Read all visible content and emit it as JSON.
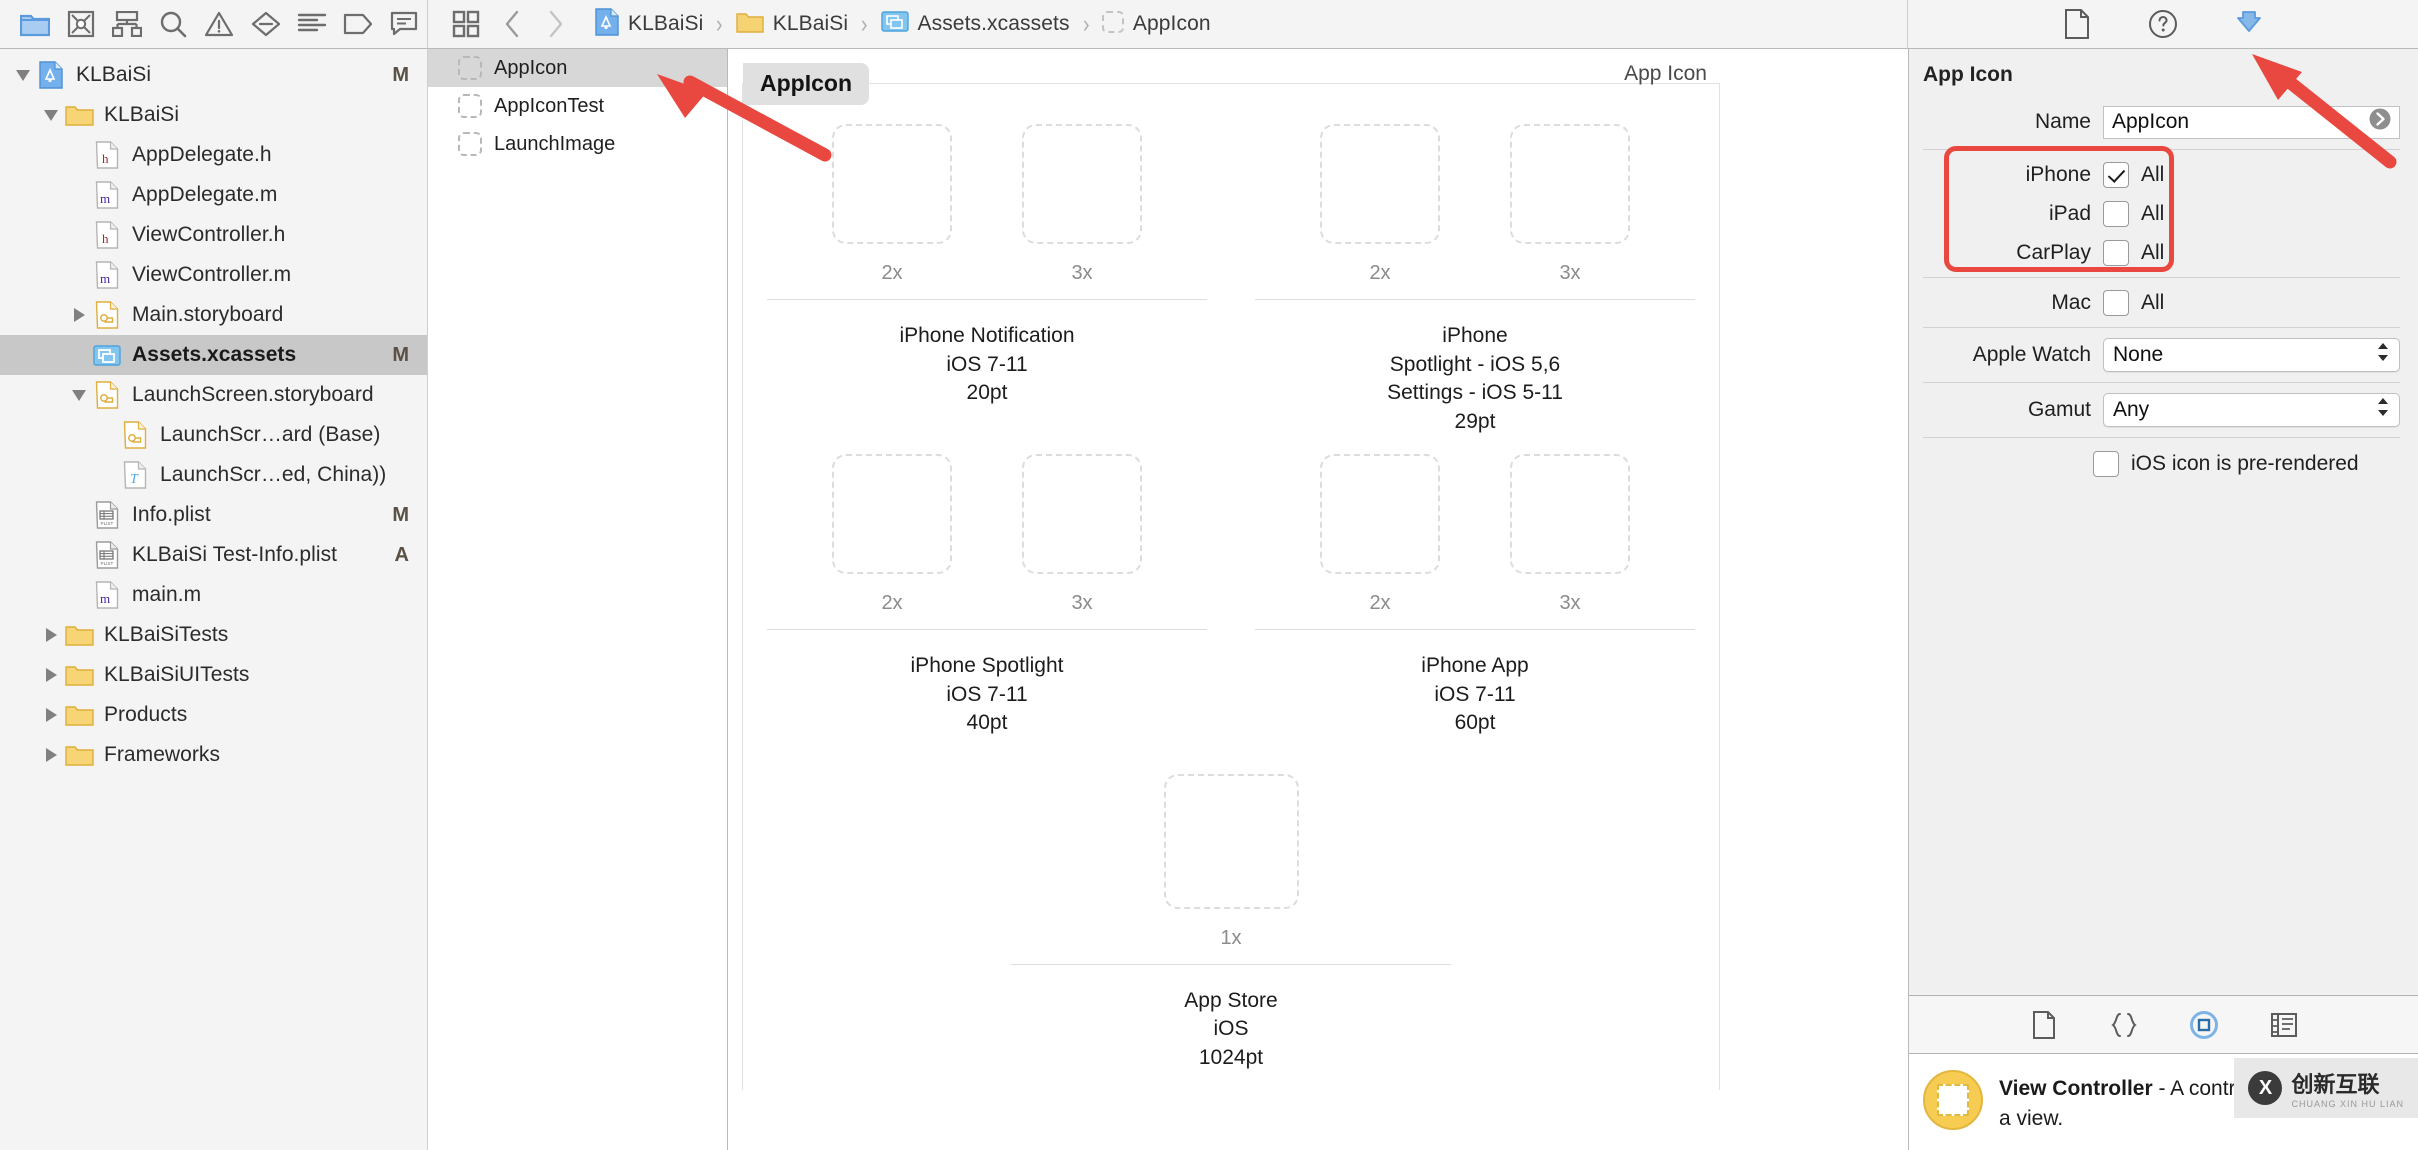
{
  "toolbar": {
    "left_icons": [
      {
        "name": "folder-icon",
        "label": "Show the Project navigator",
        "active": true
      },
      {
        "name": "source-control-icon",
        "label": "Show the Source Control navigator",
        "active": false
      },
      {
        "name": "hierarchy-icon",
        "label": "Show the Symbol navigator",
        "active": false
      },
      {
        "name": "search-icon",
        "label": "Show the Find navigator",
        "active": false
      },
      {
        "name": "warning-icon",
        "label": "Show the Issue navigator",
        "active": false
      },
      {
        "name": "test-icon",
        "label": "Show the Test navigator",
        "active": false
      },
      {
        "name": "debug-icon",
        "label": "Show the Debug navigator",
        "active": false
      },
      {
        "name": "breakpoint-icon",
        "label": "Show the Breakpoint navigator",
        "active": false
      },
      {
        "name": "report-icon",
        "label": "Show the Report navigator",
        "active": false
      }
    ],
    "grid_button": "editor-layout-icon",
    "back_button": "chevron-left-icon",
    "forward_button": "chevron-right-icon",
    "right_icons": [
      {
        "name": "file-inspector-icon",
        "label": "File inspector",
        "active": false
      },
      {
        "name": "quick-help-icon",
        "label": "Quick Help inspector",
        "active": false
      },
      {
        "name": "attributes-inspector-icon",
        "label": "Attributes inspector",
        "active": true
      }
    ]
  },
  "breadcrumb": [
    {
      "label": "KLBaiSi",
      "icon": "xcode-project-icon"
    },
    {
      "label": "KLBaiSi",
      "icon": "folder-icon"
    },
    {
      "label": "Assets.xcassets",
      "icon": "assets-catalog-icon"
    },
    {
      "label": "AppIcon",
      "icon": "appicon-placeholder-icon"
    }
  ],
  "breadcrumb_separator": "›",
  "navigator": {
    "items": [
      {
        "label": "KLBaiSi",
        "icon": "xcode-project-icon",
        "indent": 0,
        "disclosure": "open",
        "status": "M",
        "selected": false
      },
      {
        "label": "KLBaiSi",
        "icon": "folder-icon",
        "indent": 1,
        "disclosure": "open",
        "status": "",
        "selected": false
      },
      {
        "label": "AppDelegate.h",
        "icon": "header-file-icon",
        "indent": 2,
        "disclosure": "none",
        "status": "",
        "selected": false
      },
      {
        "label": "AppDelegate.m",
        "icon": "objc-file-icon",
        "indent": 2,
        "disclosure": "none",
        "status": "",
        "selected": false
      },
      {
        "label": "ViewController.h",
        "icon": "header-file-icon",
        "indent": 2,
        "disclosure": "none",
        "status": "",
        "selected": false
      },
      {
        "label": "ViewController.m",
        "icon": "objc-file-icon",
        "indent": 2,
        "disclosure": "none",
        "status": "",
        "selected": false
      },
      {
        "label": "Main.storyboard",
        "icon": "storyboard-file-icon",
        "indent": 2,
        "disclosure": "closed",
        "status": "",
        "selected": false
      },
      {
        "label": "Assets.xcassets",
        "icon": "assets-catalog-icon",
        "indent": 2,
        "disclosure": "none",
        "status": "M",
        "selected": true
      },
      {
        "label": "LaunchScreen.storyboard",
        "icon": "storyboard-file-icon",
        "indent": 2,
        "disclosure": "open",
        "status": "",
        "selected": false
      },
      {
        "label": "LaunchScr…ard (Base)",
        "icon": "storyboard-file-icon",
        "indent": 3,
        "disclosure": "none",
        "status": "",
        "selected": false
      },
      {
        "label": "LaunchScr…ed, China))",
        "icon": "strings-file-icon",
        "indent": 3,
        "disclosure": "none",
        "status": "",
        "selected": false
      },
      {
        "label": "Info.plist",
        "icon": "plist-file-icon",
        "indent": 2,
        "disclosure": "none",
        "status": "M",
        "selected": false
      },
      {
        "label": "KLBaiSi Test-Info.plist",
        "icon": "plist-file-icon",
        "indent": 2,
        "disclosure": "none",
        "status": "A",
        "selected": false
      },
      {
        "label": "main.m",
        "icon": "objc-file-icon",
        "indent": 2,
        "disclosure": "none",
        "status": "",
        "selected": false
      },
      {
        "label": "KLBaiSiTests",
        "icon": "folder-icon",
        "indent": 1,
        "disclosure": "closed",
        "status": "",
        "selected": false
      },
      {
        "label": "KLBaiSiUITests",
        "icon": "folder-icon",
        "indent": 1,
        "disclosure": "closed",
        "status": "",
        "selected": false
      },
      {
        "label": "Products",
        "icon": "folder-icon",
        "indent": 1,
        "disclosure": "closed",
        "status": "",
        "selected": false
      },
      {
        "label": "Frameworks",
        "icon": "folder-icon",
        "indent": 1,
        "disclosure": "closed",
        "status": "",
        "selected": false
      }
    ]
  },
  "asset_list": {
    "items": [
      {
        "label": "AppIcon",
        "selected": true
      },
      {
        "label": "AppIconTest",
        "selected": false
      },
      {
        "label": "LaunchImage",
        "selected": false
      }
    ]
  },
  "canvas": {
    "title": "AppIcon",
    "corner_label": "App Icon",
    "groups": [
      {
        "caption_line1": "iPhone Notification",
        "caption_line2": "iOS 7-11",
        "caption_line3": "20pt",
        "slots": [
          {
            "scale": "2x"
          },
          {
            "scale": "3x"
          }
        ]
      },
      {
        "caption_line1": "iPhone",
        "caption_line2": "Spotlight - iOS 5,6",
        "caption_line3": "Settings - iOS 5-11",
        "caption_line4": "29pt",
        "slots": [
          {
            "scale": "2x"
          },
          {
            "scale": "3x"
          }
        ]
      },
      {
        "caption_line1": "iPhone Spotlight",
        "caption_line2": "iOS 7-11",
        "caption_line3": "40pt",
        "slots": [
          {
            "scale": "2x"
          },
          {
            "scale": "3x"
          }
        ]
      },
      {
        "caption_line1": "iPhone App",
        "caption_line2": "iOS 7-11",
        "caption_line3": "60pt",
        "slots": [
          {
            "scale": "2x"
          },
          {
            "scale": "3x"
          }
        ]
      },
      {
        "caption_line1": "App Store",
        "caption_line2": "iOS",
        "caption_line3": "1024pt",
        "slots": [
          {
            "scale": "1x"
          }
        ]
      }
    ]
  },
  "inspector": {
    "title": "App Icon",
    "name_label": "Name",
    "name_value": "AppIcon",
    "devices": [
      {
        "label": "iPhone",
        "checked": true,
        "option": "All"
      },
      {
        "label": "iPad",
        "checked": false,
        "option": "All"
      },
      {
        "label": "CarPlay",
        "checked": false,
        "option": "All"
      },
      {
        "label": "Mac",
        "checked": false,
        "option": "All"
      }
    ],
    "apple_watch_label": "Apple Watch",
    "apple_watch_value": "None",
    "gamut_label": "Gamut",
    "gamut_value": "Any",
    "prerendered_label": "iOS icon is pre-rendered",
    "prerendered_checked": false
  },
  "library": {
    "tabs": [
      {
        "name": "file-template-library-icon",
        "active": false
      },
      {
        "name": "code-snippet-library-icon",
        "active": false
      },
      {
        "name": "object-library-icon",
        "active": true
      },
      {
        "name": "media-library-icon",
        "active": false
      }
    ],
    "item_title": "View Controller",
    "item_description": " - A controller that manages a view."
  },
  "watermark": {
    "mark": "X",
    "title": "创新互联",
    "subtitle": "CHUANG XIN HU LIAN"
  },
  "colors": {
    "accent_blue": "#7eb3e8",
    "selection_gray": "#c8c8c8",
    "annotation_red": "#e8483f",
    "status_text": "#5a5044"
  }
}
